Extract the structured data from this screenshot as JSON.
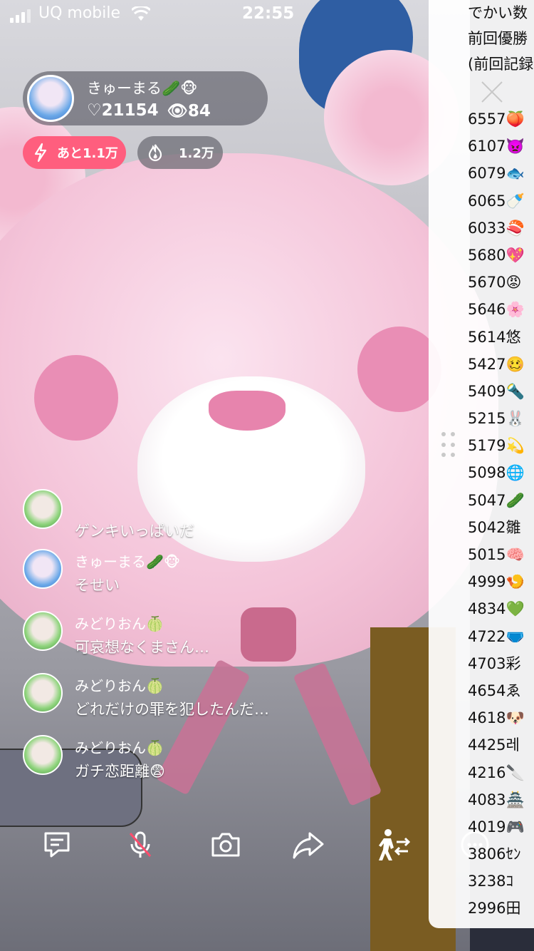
{
  "status_bar": {
    "carrier": "UQ mobile",
    "time": "22:55"
  },
  "streamer": {
    "name": "きゅーまる🥒🐵",
    "likes": "♡21154",
    "viewers": "👁84"
  },
  "badges": {
    "goal_label": "あと1.1万",
    "fire_label": "1.2万"
  },
  "chat": [
    {
      "user": "",
      "message": "ゲンキいっぱいだ",
      "avatar": "green"
    },
    {
      "user": "きゅーまる🥒🐵",
      "message": "そせい",
      "avatar": "blue"
    },
    {
      "user": "みどりおん🍈",
      "message": "可哀想なくまさん…",
      "avatar": "green"
    },
    {
      "user": "みどりおん🍈",
      "message": "どれだけの罪を犯したんだ…",
      "avatar": "green"
    },
    {
      "user": "みどりおん🍈",
      "message": "ガチ恋距離😨",
      "avatar": "green"
    }
  ],
  "toolbar": {
    "comment": "comment-icon",
    "mic": "mic-muted-icon",
    "camera": "camera-icon",
    "share": "share-icon",
    "collab": "collab-icon",
    "more": "more-icon"
  },
  "ranking": {
    "header_lines": [
      "でかい数",
      "前回優勝",
      "(前回記録"
    ],
    "rows": [
      "6557🍑",
      "6107👿",
      "6079🐟",
      "6065🍼",
      "6033🍣",
      "5680💖",
      "5670😡",
      "5646🌸",
      "5614悠",
      "5427🥴",
      "5409🔦",
      "5215🐰",
      "5179💫",
      "5098🌐",
      "5047🥒",
      "5042雛",
      "5015🧠",
      "4999🍤",
      "4834💚",
      "4722🩲",
      "4703彩",
      "4654ゑ",
      "4618🐶",
      "4425레",
      "4216🔪",
      "4083🏯",
      "4019🎮",
      "3806ｾﾝ",
      "3238ｺ",
      "2996田"
    ]
  },
  "colors": {
    "goal_pill": "#ff5e7e",
    "panel_bg": "#ffffff"
  }
}
